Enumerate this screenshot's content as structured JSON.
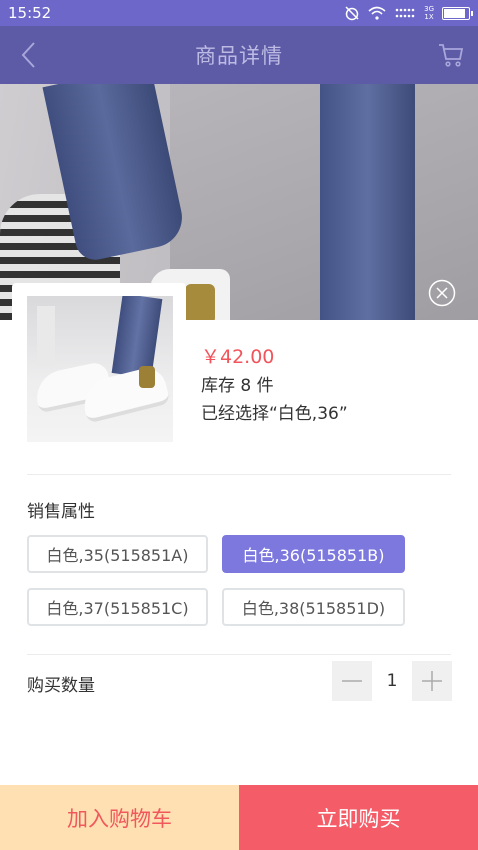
{
  "status_bar": {
    "time": "15:52",
    "network_top": "3G",
    "network_bottom": "1X"
  },
  "header": {
    "title": "商品详情"
  },
  "product": {
    "price": "￥42.00",
    "stock": "库存 8 件",
    "selected": "已经选择“白色,36”"
  },
  "attributes": {
    "label": "销售属性",
    "options": [
      {
        "label": "白色,35(515851A)",
        "selected": false
      },
      {
        "label": "白色,36(515851B)",
        "selected": true
      },
      {
        "label": "白色,37(515851C)",
        "selected": false
      },
      {
        "label": "白色,38(515851D)",
        "selected": false
      }
    ]
  },
  "quantity": {
    "label": "购买数量",
    "value": "1"
  },
  "actions": {
    "add_to_cart": "加入购物车",
    "buy_now": "立即购买"
  },
  "colors": {
    "accent": "#7c78de",
    "header": "#5d5aa6",
    "price": "#f2545b",
    "buy": "#f45d68",
    "cart": "#ffe0b2"
  }
}
